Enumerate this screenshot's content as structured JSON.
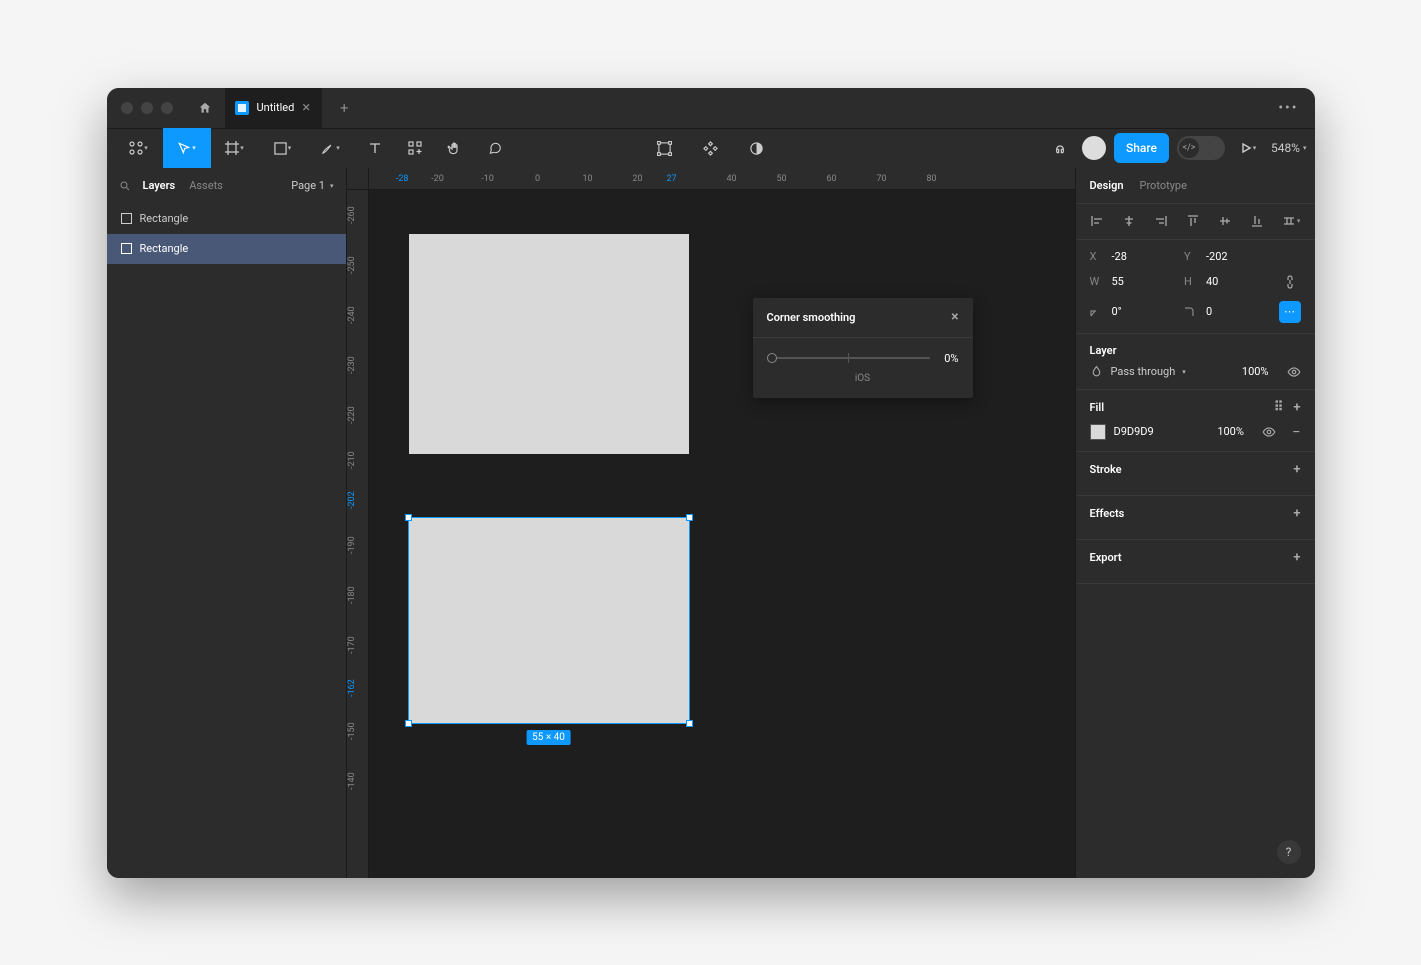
{
  "tab": {
    "title": "Untitled"
  },
  "toolbar": {
    "share": "Share",
    "zoom": "548%"
  },
  "left": {
    "tabs": {
      "layers": "Layers",
      "assets": "Assets"
    },
    "page": "Page 1",
    "layers": [
      {
        "name": "Rectangle",
        "selected": false
      },
      {
        "name": "Rectangle",
        "selected": true
      }
    ]
  },
  "ruler_h": [
    "-28",
    "-20",
    "-10",
    "0",
    "10",
    "20",
    "27",
    "40",
    "50",
    "60",
    "70",
    "80"
  ],
  "ruler_v": [
    "-260",
    "-250",
    "-240",
    "-230",
    "-220",
    "-210",
    "-202",
    "-190",
    "-180",
    "-170",
    "-162",
    "-150",
    "-140"
  ],
  "selection_badge": "55 × 40",
  "popup": {
    "title": "Corner smoothing",
    "value": "0%",
    "preset": "iOS"
  },
  "design": {
    "tabs": {
      "design": "Design",
      "prototype": "Prototype"
    },
    "x": "-28",
    "y": "-202",
    "w": "55",
    "h": "40",
    "rotation": "0°",
    "radius": "0",
    "layer_section": "Layer",
    "blend": "Pass through",
    "opacity": "100%",
    "fill_section": "Fill",
    "fill_hex": "D9D9D9",
    "fill_opacity": "100%",
    "stroke_section": "Stroke",
    "effects_section": "Effects",
    "export_section": "Export"
  }
}
